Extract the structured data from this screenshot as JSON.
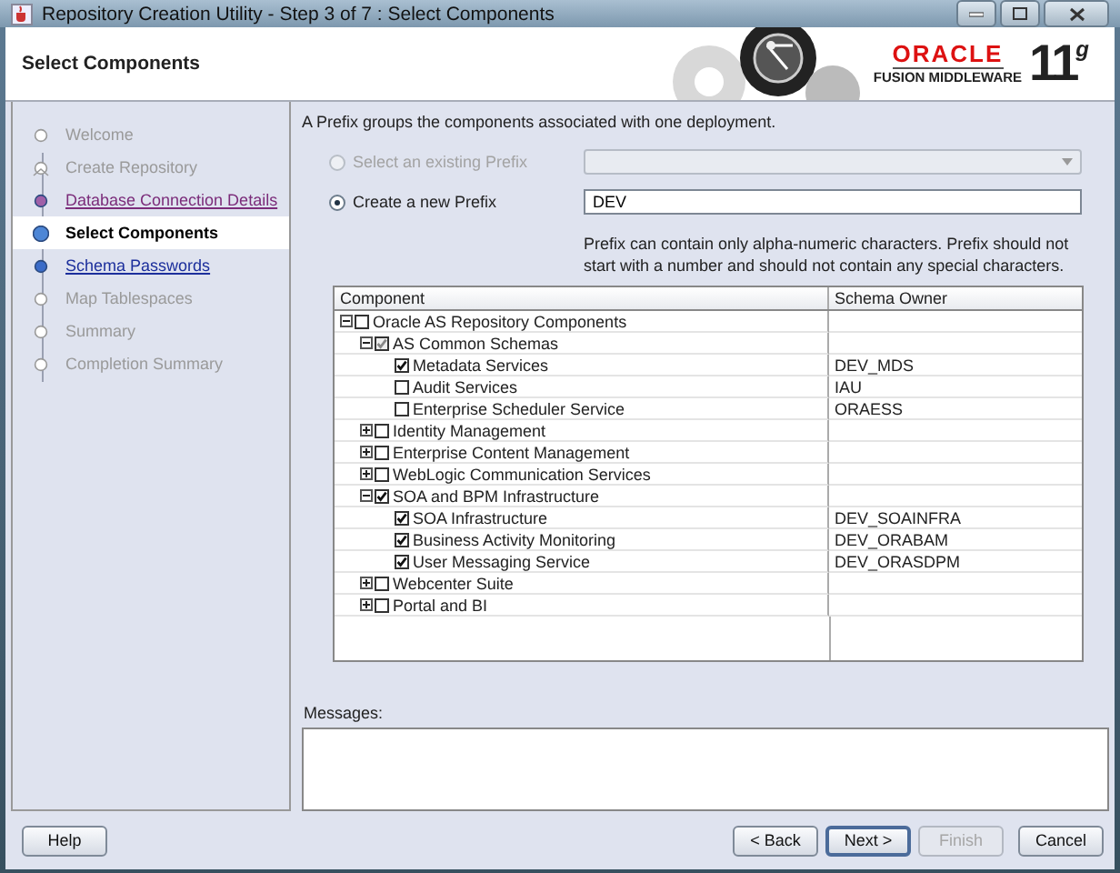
{
  "window": {
    "title": "Repository Creation Utility - Step 3 of 7 : Select Components"
  },
  "header": {
    "title": "Select Components",
    "logo": {
      "brand": "ORACLE",
      "product": "FUSION MIDDLEWARE",
      "version": "11$^{g}$"
    }
  },
  "steps": [
    {
      "label": "Welcome",
      "kind": "inactive",
      "selected": false
    },
    {
      "label": "Create Repository",
      "kind": "branch",
      "selected": false
    },
    {
      "label": "Database Connection Details",
      "kind": "visited",
      "selected": false
    },
    {
      "label": "Select Components",
      "kind": "current",
      "selected": true
    },
    {
      "label": "Schema Passwords",
      "kind": "link",
      "selected": false
    },
    {
      "label": "Map Tablespaces",
      "kind": "inactive",
      "selected": false
    },
    {
      "label": "Summary",
      "kind": "inactive",
      "selected": false
    },
    {
      "label": "Completion Summary",
      "kind": "inactive",
      "selected": false
    }
  ],
  "intro": "A Prefix groups the components associated with one deployment.",
  "prefix_options": [
    {
      "label": "Select an existing Prefix",
      "selected": false,
      "disabled": true,
      "kind": "combo"
    },
    {
      "label": "Create a new Prefix",
      "selected": true,
      "disabled": false,
      "kind": "text",
      "value": "DEV"
    }
  ],
  "prefix_hint": "Prefix can contain only alpha-numeric characters. Prefix should not start with a number and should not contain any special characters.",
  "table": {
    "columns": [
      "Component",
      "Schema Owner"
    ],
    "rows": [
      {
        "name": "Oracle AS Repository Components",
        "checked": false,
        "partial": false,
        "expanded": true,
        "children": [
          {
            "name": "AS Common Schemas",
            "checked": true,
            "partial": true,
            "expanded": true,
            "children": [
              {
                "name": "Metadata Services",
                "checked": true,
                "partial": false,
                "owner": "DEV_MDS"
              },
              {
                "name": "Audit Services",
                "checked": false,
                "partial": false,
                "owner": "IAU"
              },
              {
                "name": "Enterprise Scheduler Service",
                "checked": false,
                "partial": false,
                "owner": "ORAESS"
              }
            ]
          },
          {
            "name": "Identity Management",
            "checked": false,
            "partial": false,
            "expanded": false
          },
          {
            "name": "Enterprise Content Management",
            "checked": false,
            "partial": false,
            "expanded": false
          },
          {
            "name": "WebLogic Communication Services",
            "checked": false,
            "partial": false,
            "expanded": false
          },
          {
            "name": "SOA and BPM Infrastructure",
            "checked": true,
            "partial": false,
            "expanded": true,
            "children": [
              {
                "name": "SOA Infrastructure",
                "checked": true,
                "partial": false,
                "owner": "DEV_SOAINFRA"
              },
              {
                "name": "Business Activity Monitoring",
                "checked": true,
                "partial": false,
                "owner": "DEV_ORABAM"
              },
              {
                "name": "User Messaging Service",
                "checked": true,
                "partial": false,
                "owner": "DEV_ORASDPM"
              }
            ]
          },
          {
            "name": "Webcenter Suite",
            "checked": false,
            "partial": false,
            "expanded": false
          },
          {
            "name": "Portal and BI",
            "checked": false,
            "partial": false,
            "expanded": false
          }
        ]
      }
    ]
  },
  "messages": {
    "label": "Messages:"
  },
  "buttons": [
    {
      "label": "Help",
      "kind": "help",
      "default": false,
      "disabled": false
    },
    {
      "label": "< Back",
      "kind": "nav",
      "default": false,
      "disabled": false
    },
    {
      "label": "Next >",
      "kind": "nav",
      "default": true,
      "disabled": false
    },
    {
      "label": "Finish",
      "kind": "nav",
      "default": false,
      "disabled": true
    },
    {
      "label": "Cancel",
      "kind": "nav",
      "default": false,
      "disabled": false
    }
  ]
}
